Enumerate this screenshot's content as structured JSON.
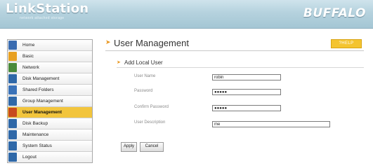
{
  "header": {
    "brand_title": "LinkStation",
    "brand_subtitle": "network attached storage",
    "vendor_logo": "BUFFALO",
    "bg_color": "#b5d2de"
  },
  "sidebar": {
    "items": [
      {
        "label": "Home",
        "icon": "home-icon",
        "color": "#3a6cb0",
        "active": false
      },
      {
        "label": "Basic",
        "icon": "basic-icon",
        "color": "#e8a020",
        "active": false
      },
      {
        "label": "Network",
        "icon": "network-icon",
        "color": "#4a8a3a",
        "active": false
      },
      {
        "label": "Disk Management",
        "icon": "disk-management-icon",
        "color": "#2f68a8",
        "active": false
      },
      {
        "label": "Shared Folders",
        "icon": "shared-folders-icon",
        "color": "#3a72b8",
        "active": false
      },
      {
        "label": "Group Management",
        "icon": "group-management-icon",
        "color": "#2f68a8",
        "active": false
      },
      {
        "label": "User Management",
        "icon": "user-management-icon",
        "color": "#c84a1e",
        "active": true
      },
      {
        "label": "Disk Backup",
        "icon": "disk-backup-icon",
        "color": "#2f68a8",
        "active": false
      },
      {
        "label": "Maintenance",
        "icon": "maintenance-icon",
        "color": "#2f68a8",
        "active": false
      },
      {
        "label": "System Status",
        "icon": "system-status-icon",
        "color": "#2f68a8",
        "active": false
      },
      {
        "label": "Logout",
        "icon": "logout-icon",
        "color": "#2f68a8",
        "active": false
      }
    ],
    "active_color": "#f2c53d"
  },
  "main": {
    "title": "User Management",
    "help_label": "?HELP",
    "accent_color": "#e8961e",
    "section": {
      "title": "Add Local User",
      "fields": [
        {
          "label": "User Name",
          "value": "robin"
        },
        {
          "label": "Password",
          "value": "●●●●●"
        },
        {
          "label": "Confirm Password",
          "value": "●●●●●"
        },
        {
          "label": "User Description",
          "value": "me"
        }
      ]
    },
    "buttons": {
      "apply": "Apply",
      "cancel": "Cancel"
    }
  }
}
